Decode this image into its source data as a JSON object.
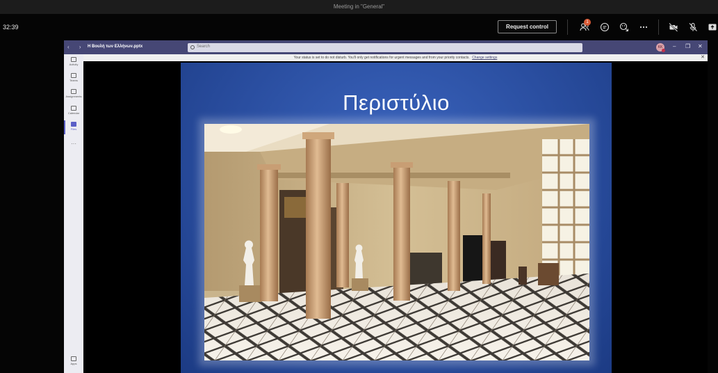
{
  "window": {
    "title": "Meeting in \"General\""
  },
  "meeting": {
    "timer": "32:39",
    "request_control_label": "Request control",
    "participants_badge": "1"
  },
  "teams": {
    "nav": "‹ ›",
    "file_title": "Η Βουλή των Ελλήνων.pptx",
    "search_placeholder": "Search",
    "avatar_initials": "KK",
    "notification": {
      "text": "Your status is set to do not disturb. You'll only get notifications for urgent messages and from your priority contacts.",
      "link": "Change settings"
    },
    "rail": [
      {
        "label": "Activity"
      },
      {
        "label": "Teams"
      },
      {
        "label": "Assignments"
      },
      {
        "label": "Calendar"
      },
      {
        "label": "Files"
      },
      {
        "label": "Apps"
      }
    ],
    "more": "···"
  },
  "slide": {
    "title": "Περιστύλιο"
  },
  "colors": {
    "teams_header": "#464775",
    "accent": "#5b5fc7",
    "slide_blue": "#2a4ea0",
    "badge": "#d95a35"
  },
  "icons": [
    "people-icon",
    "chat-icon",
    "reactions-icon",
    "more-icon",
    "camera-off-icon",
    "mic-off-icon",
    "share-icon"
  ]
}
